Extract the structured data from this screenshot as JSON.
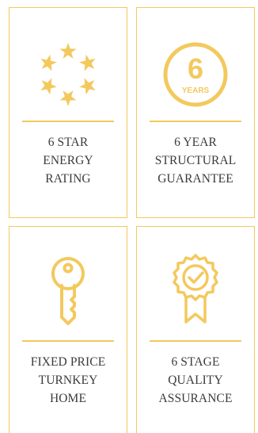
{
  "accent_color": "#f3c95e",
  "cards": [
    {
      "icon": "six-stars-circle-icon",
      "label": "6 STAR\nENERGY\nRATING"
    },
    {
      "icon": "six-years-badge-icon",
      "badge_number": "6",
      "badge_text": "YEARS",
      "label": "6 YEAR\nSTRUCTURAL\nGUARANTEE"
    },
    {
      "icon": "key-icon",
      "label": "FIXED PRICE\nTURNKEY\nHOME"
    },
    {
      "icon": "quality-rosette-check-icon",
      "label": "6 STAGE\nQUALITY\nASSURANCE"
    }
  ]
}
